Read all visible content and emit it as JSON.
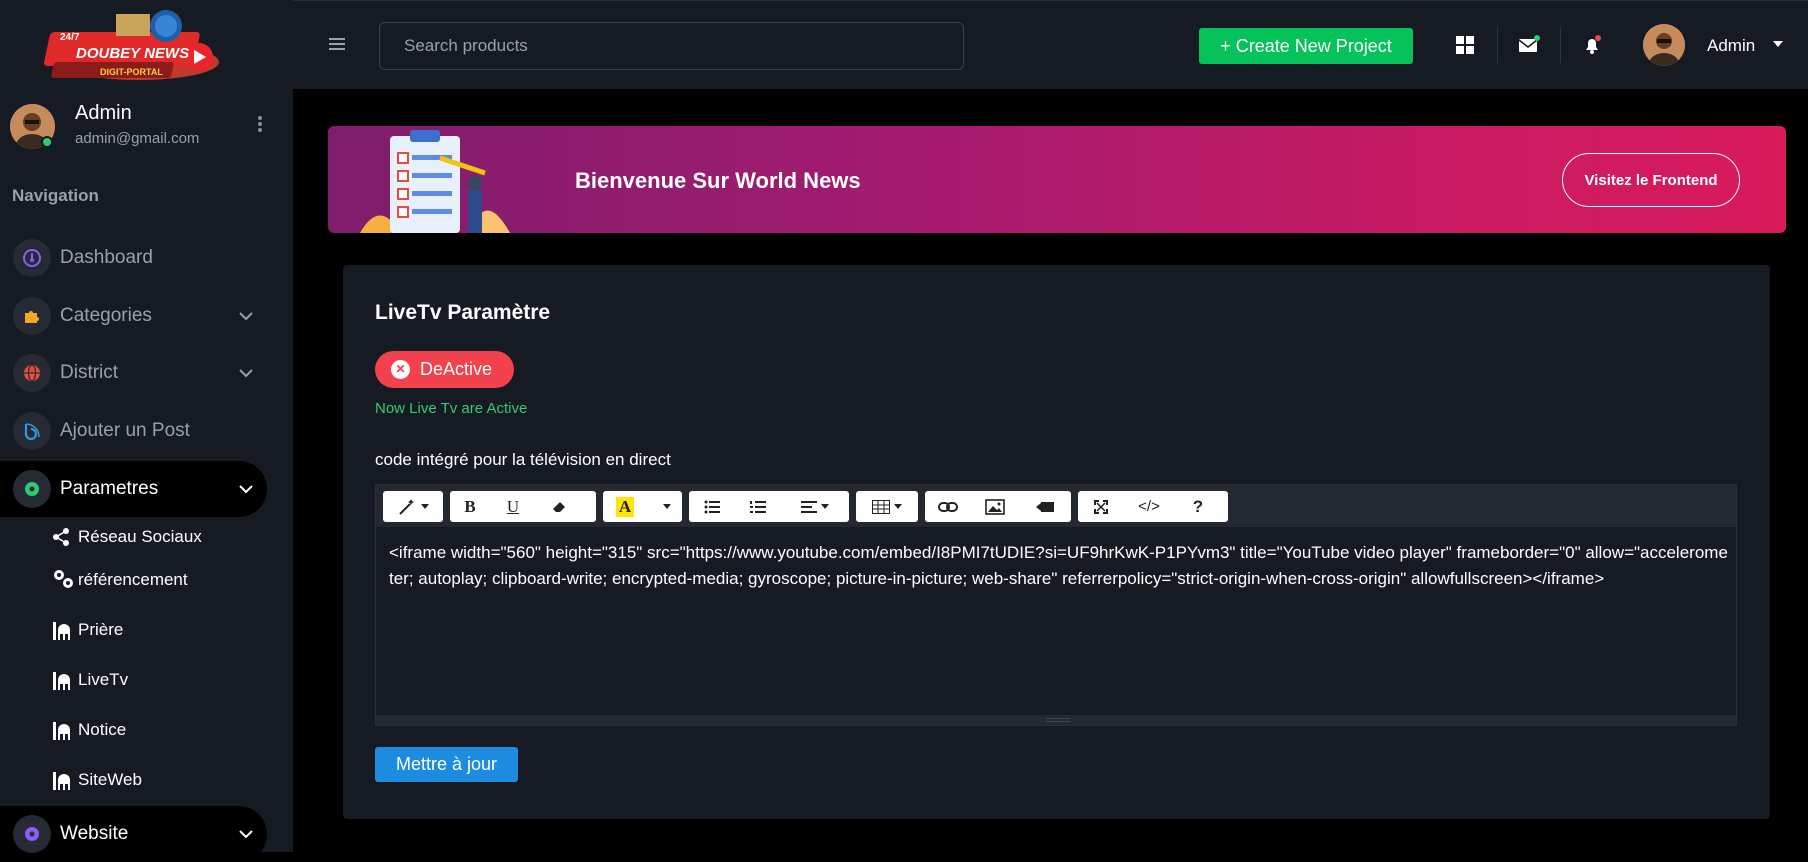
{
  "sidebar": {
    "logo_text": "DOUBEY NEWS",
    "logo_sub": "DIGIT-PORTAL",
    "logo_tag": "24/7",
    "user": {
      "name": "Admin",
      "email": "admin@gmail.com"
    },
    "nav_heading": "Navigation",
    "items": [
      {
        "label": "Dashboard",
        "icon": "dashboard-icon"
      },
      {
        "label": "Categories",
        "icon": "puzzle-icon"
      },
      {
        "label": "District",
        "icon": "globe-icon"
      },
      {
        "label": "Ajouter un Post",
        "icon": "blog-icon"
      },
      {
        "label": "Parametres",
        "icon": "gear-icon"
      },
      {
        "label": "Website",
        "icon": "gear-icon"
      }
    ],
    "sub_items": [
      {
        "label": "Réseau Sociaux",
        "icon": "share-icon"
      },
      {
        "label": "référencement",
        "icon": "gears-icon"
      },
      {
        "label": "Prière",
        "icon": "mosque-icon"
      },
      {
        "label": "LiveTv",
        "icon": "mosque-icon"
      },
      {
        "label": "Notice",
        "icon": "mosque-icon"
      },
      {
        "label": "SiteWeb",
        "icon": "mosque-icon"
      }
    ]
  },
  "topbar": {
    "search_placeholder": "Search products",
    "create_label": "+ Create New Project",
    "admin_label": "Admin"
  },
  "banner": {
    "title": "Bienvenue Sur World News",
    "button_label": "Visitez le Frontend"
  },
  "card": {
    "title": "LiveTv Paramètre",
    "deactive_label": "DeActive",
    "status_text": "Now Live Tv are Active",
    "embed_label": "code intégré pour la télévision en direct",
    "embed_code": "<iframe width=\"560\" height=\"315\" src=\"https://www.youtube.com/embed/I8PMI7tUDIE?si=UF9hrKwK-P1PYvm3\" title=\"YouTube video player\" frameborder=\"0\" allow=\"accelerometer; autoplay; clipboard-write; encrypted-media; gyroscope; picture-in-picture; web-share\" referrerpolicy=\"strict-origin-when-cross-origin\" allowfullscreen></iframe>",
    "update_label": "Mettre à jour"
  },
  "colors": {
    "accent_green": "#05c25b",
    "danger": "#f2424d",
    "primary": "#1d8ce0",
    "banner_start": "#7f1d6d",
    "banner_end": "#d91a5b"
  }
}
